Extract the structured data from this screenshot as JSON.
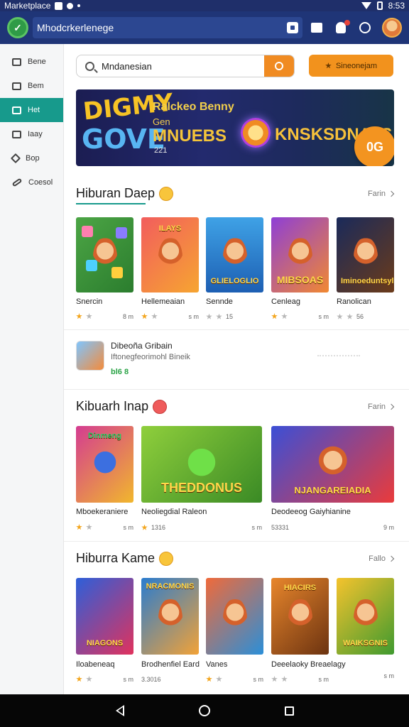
{
  "status_bar": {
    "app_label": "Marketplace",
    "time": "8:53"
  },
  "app_bar": {
    "title": "Mhodcrkerlenege"
  },
  "sidebar": {
    "items": [
      {
        "label": "Bene",
        "active": false
      },
      {
        "label": "Bem",
        "active": false
      },
      {
        "label": "Het",
        "active": true
      },
      {
        "label": "Iaay",
        "active": false
      },
      {
        "label": "Bop",
        "active": false
      },
      {
        "label": "Coesol",
        "active": false
      }
    ]
  },
  "search": {
    "value": "Mndanesian",
    "promo_label": "Sineonejam"
  },
  "banner": {
    "logo_top": "DIGMY",
    "logo_bottom": "GOVE",
    "line1": "Ralckeo Benny",
    "line2": "Gen",
    "line3": "MNUEBS",
    "line4": "221",
    "line5": "KNSKSDNAIIS",
    "badge": "0G"
  },
  "sections": [
    {
      "title": "Hiburan Daep",
      "see_more": "Farin",
      "games": [
        {
          "name": "Snercin",
          "caption": "",
          "rating": "",
          "size": "8 m"
        },
        {
          "name": "Hellemeaian",
          "caption": "ILAYS",
          "rating": "",
          "size": "s m"
        },
        {
          "name": "Sennde",
          "caption": "GLIELOGLIO",
          "rating": "15",
          "size": ""
        },
        {
          "name": "Cenleag",
          "caption": "MIBSOAS",
          "rating": "",
          "size": "s m"
        },
        {
          "name": "Ranolican",
          "caption": "Iminoeduntsyl",
          "rating": "56",
          "size": ""
        }
      ]
    },
    {
      "title": "Kibuarh Inap",
      "see_more": "Farin",
      "games": [
        {
          "name": "Mboekeraniere",
          "caption": "Dinmeng",
          "rating": "",
          "size": "s m"
        },
        {
          "name": "Neoliegdial Raleon",
          "caption": "THEDDONUS",
          "rating": "1316",
          "size": "s m"
        },
        {
          "name": "Deodeeog Gaiyhianine",
          "caption": "NJANGAREIADIA",
          "rating": "53331",
          "size": "9 m"
        }
      ]
    },
    {
      "title": "Hiburra Kame",
      "see_more": "Fallo",
      "games": [
        {
          "name": "Iloabeneaq",
          "caption": "NIAGONS",
          "rating": "",
          "size": "s m"
        },
        {
          "name": "Brodhenfiel Eard",
          "caption": "NRACMONIS",
          "rating": "3.3016",
          "size": ""
        },
        {
          "name": "Vanes",
          "caption": "",
          "rating": "",
          "size": "s m"
        },
        {
          "name": "Deeelaoky Breaelagy",
          "caption": "HIACIRS",
          "rating": "",
          "size": "s m"
        },
        {
          "name": "",
          "caption": "WAIKSGNIS",
          "rating": "",
          "size": "s m"
        }
      ]
    }
  ],
  "featured": {
    "title": "Dibeoña Gribain",
    "subtitle": "Iftonegfeorimohl Bineik",
    "price": "bl6 8"
  }
}
